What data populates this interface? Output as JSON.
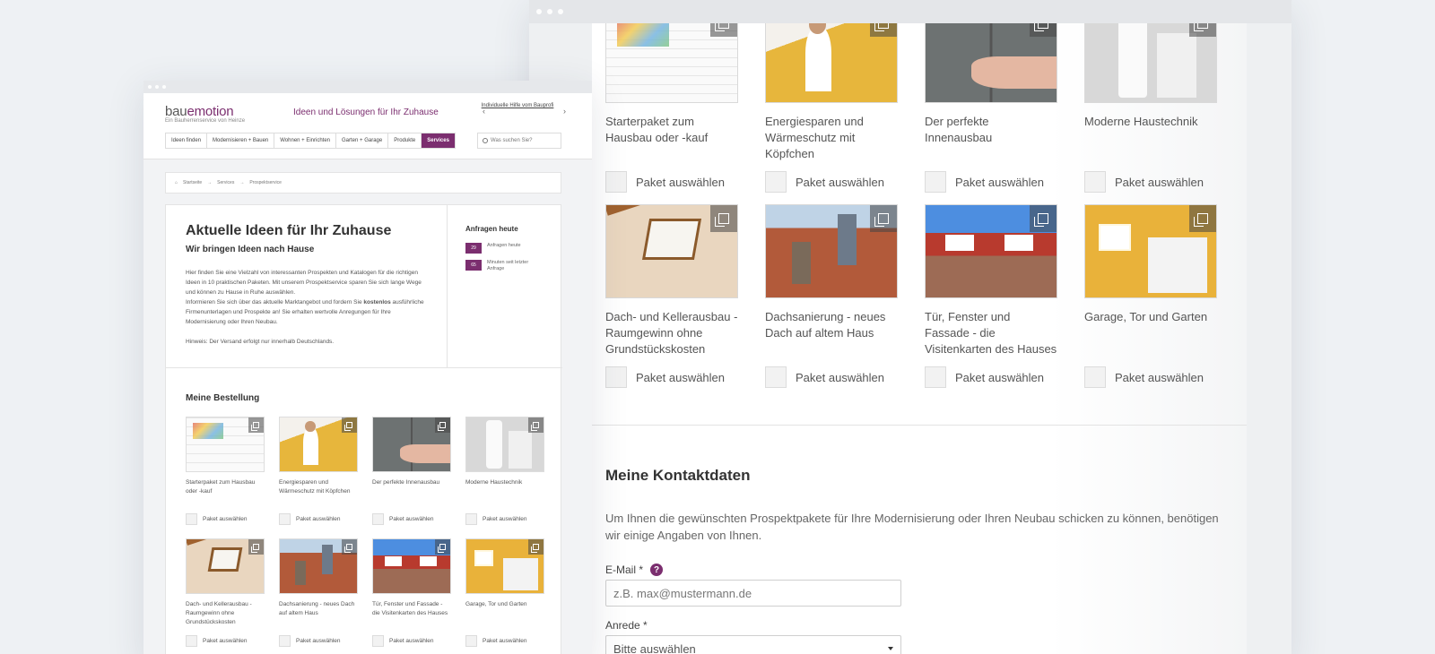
{
  "colors": {
    "brand": "#7b2e6f",
    "background": "#eef1f4"
  },
  "site": {
    "logo_prefix": "bau",
    "logo_suffix": "emotion",
    "logo_sub": "Ein Bauherrenservice von Heinze",
    "tagline": "Ideen und Lösungen für Ihr Zuhause",
    "help_link": "Individuelle Hilfe vom Bauprofi",
    "search_placeholder": "Was suchen Sie?",
    "nav": [
      "Ideen finden",
      "Modernisieren + Bauen",
      "Wohnen + Einrichten",
      "Garten + Garage",
      "Produkte",
      "Services"
    ]
  },
  "breadcrumb": [
    "Startseite",
    "Services",
    "Prospektservice"
  ],
  "intro": {
    "title": "Aktuelle Ideen für Ihr Zuhause",
    "subtitle": "Wir bringen Ideen nach Hause",
    "text_1": "Hier finden Sie eine Vielzahl von interessanten Prospekten und Katalogen für die richtigen Ideen in 10 praktischen Paketen. Mit unserem Prospektservice sparen Sie sich lange Wege und können zu Hause in Ruhe auswählen.",
    "text_2a": "Informieren Sie sich über das aktuelle Marktangebot und fordern Sie ",
    "text_2b": "kostenlos",
    "text_2c": " ausführliche Firmenunterlagen und Prospekte an! Sie erhalten wertvolle Anregungen für Ihre Modernisierung oder Ihren Neubau.",
    "note": "Hinweis: Der Versand erfolgt nur innerhalb Deutschlands."
  },
  "stats": {
    "title": "Anfragen heute",
    "items": [
      {
        "value": "29",
        "label": "Anfragen heute"
      },
      {
        "value": "65",
        "label": "Minuten seit letzter Anfrage"
      }
    ]
  },
  "order_title": "Meine Bestellung",
  "select_label": "Paket auswählen",
  "packages": [
    {
      "title": "Starterpaket zum Hausbau oder -kauf",
      "image": "blueprint"
    },
    {
      "title": "Energiesparen und Wärmeschutz mit Köpfchen",
      "image": "insulation"
    },
    {
      "title": "Der perfekte Innenausbau",
      "image": "tiles"
    },
    {
      "title": "Moderne Haustechnik",
      "image": "boiler"
    },
    {
      "title": "Dach- und Kellerausbau - Raumgewinn ohne Grundstückskosten",
      "image": "attic"
    },
    {
      "title": "Dachsanierung - neues Dach auf altem Haus",
      "image": "roofers"
    },
    {
      "title": "Tür, Fenster und Fassade - die Visitenkarten des Hauses",
      "image": "facade"
    },
    {
      "title": "Garage, Tor und Garten",
      "image": "garage"
    }
  ],
  "contact": {
    "title": "Meine Kontaktdaten",
    "text": "Um Ihnen die gewünschten Prospektpakete für Ihre Modernisierung oder Ihren Neubau schicken zu können, benötigen wir einige Angaben von Ihnen.",
    "email_label": "E-Mail *",
    "email_placeholder": "z.B. max@mustermann.de",
    "salutation_label": "Anrede *",
    "salutation_value": "Bitte auswählen"
  }
}
